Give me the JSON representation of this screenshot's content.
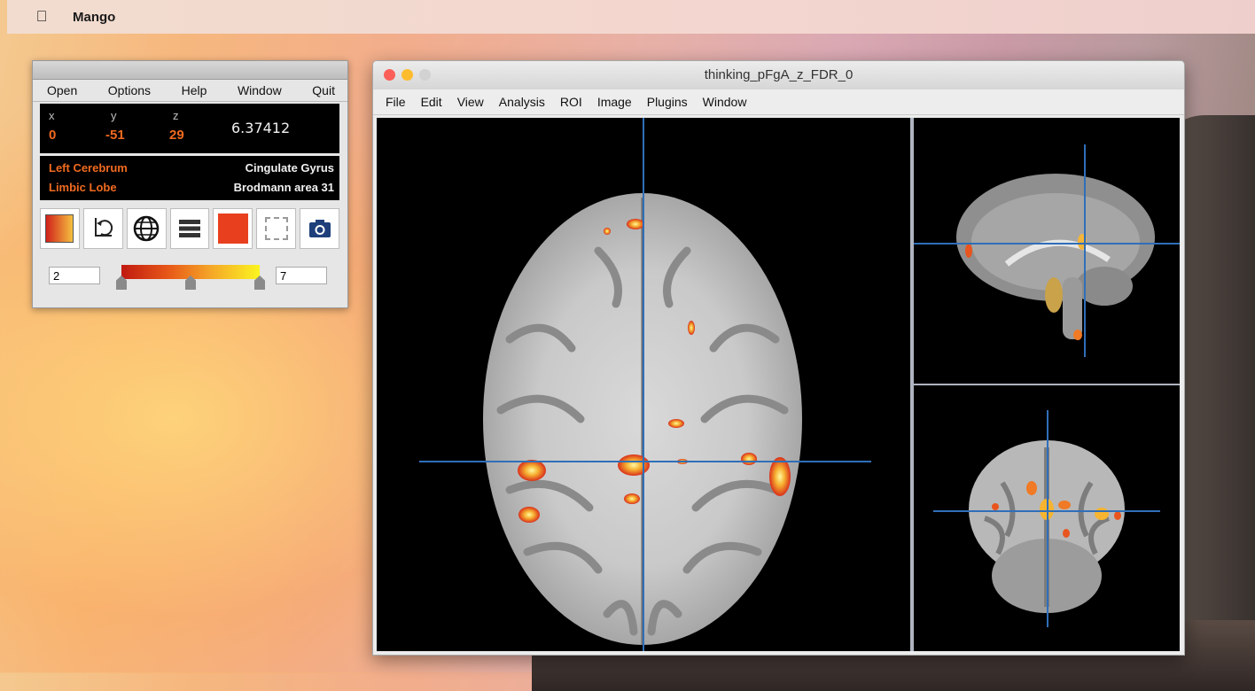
{
  "menubar": {
    "app_name": "Mango"
  },
  "toolbox": {
    "menu": [
      "Open",
      "Options",
      "Help",
      "Window",
      "Quit"
    ],
    "coords": {
      "x_label": "x",
      "y_label": "y",
      "z_label": "z",
      "x": "0",
      "y": "-51",
      "z": "29",
      "value": "6.37412"
    },
    "location": {
      "hemisphere": "Left Cerebrum",
      "gyrus": "Cingulate Gyrus",
      "lobe": "Limbic Lobe",
      "area": "Brodmann area 31"
    },
    "tools": [
      "colortable-icon",
      "undo-icon",
      "globe-icon",
      "layers-icon",
      "color-swatch-icon",
      "selection-icon",
      "camera-icon"
    ],
    "range": {
      "min": "2",
      "max": "7",
      "thumbs": [
        0,
        0.5,
        1
      ]
    },
    "colors": {
      "coord_value": "#f06a20",
      "location_text": "#f06a20"
    }
  },
  "main": {
    "title": "thinking_pFgA_z_FDR_0",
    "menu": [
      "File",
      "Edit",
      "View",
      "Analysis",
      "ROI",
      "Image",
      "Plugins",
      "Window"
    ],
    "crosshair_color": "#2f6fb8",
    "views": [
      "axial",
      "sagittal",
      "coronal"
    ]
  }
}
